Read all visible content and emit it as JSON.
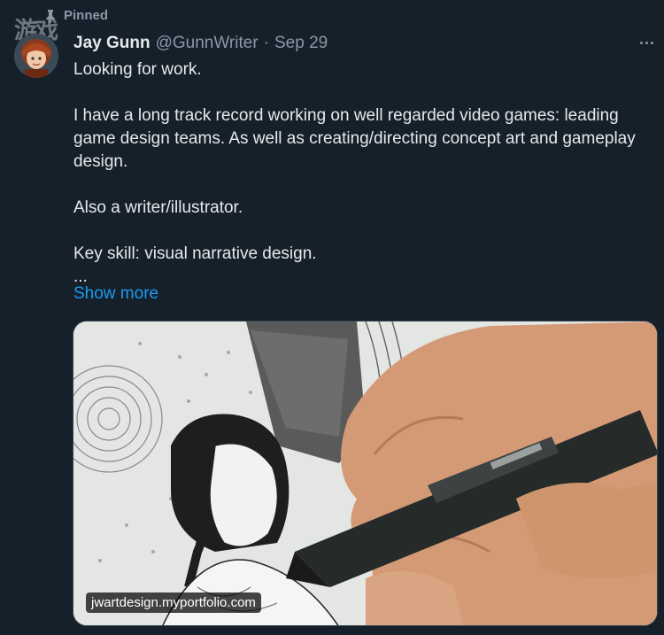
{
  "pinned": {
    "label": "Pinned"
  },
  "watermark": {
    "text": "游戏"
  },
  "author": {
    "display_name": "Jay Gunn",
    "handle": "@GunnWriter",
    "separator": "·",
    "date": "Sep 29"
  },
  "tweet": {
    "paragraphs": [
      "Looking for work.",
      "I have a long track record working on well regarded video games: leading game design teams. As well as creating/directing concept art and gameplay design.",
      "Also a writer/illustrator.",
      "Key skill: visual narrative design.",
      "..."
    ],
    "show_more_label": "Show more"
  },
  "media": {
    "description_icon": "illustration-drawing-image",
    "url_label": "jwartdesign.myportfolio.com"
  },
  "colors": {
    "background": "#15202b",
    "text_primary": "#e7e9ea",
    "text_secondary": "#8b98a5",
    "link": "#1d9bf0"
  }
}
